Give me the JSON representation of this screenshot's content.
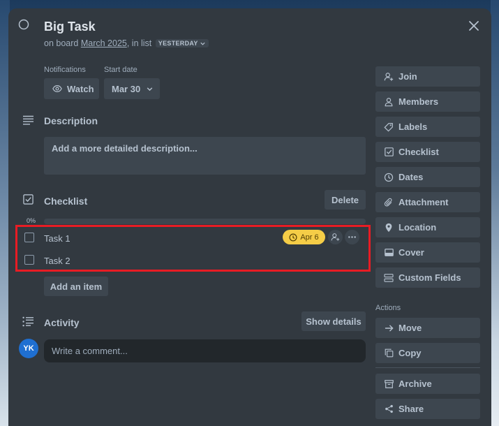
{
  "card": {
    "title": "Big Task",
    "subtitle_prefix": "on board",
    "board_name": "March 2025",
    "subtitle_mid": ", in list",
    "list_name": "YESTERDAY"
  },
  "meta": {
    "notifications_label": "Notifications",
    "watch_label": "Watch",
    "start_date_label": "Start date",
    "start_date_value": "Mar 30"
  },
  "description": {
    "heading": "Description",
    "placeholder": "Add a more detailed description..."
  },
  "checklist": {
    "heading": "Checklist",
    "delete_label": "Delete",
    "progress_text": "0%",
    "progress_value": 0,
    "items": [
      {
        "label": "Task 1",
        "checked": false,
        "due": "Apr 6"
      },
      {
        "label": "Task 2",
        "checked": false
      }
    ],
    "add_item_label": "Add an item"
  },
  "activity": {
    "heading": "Activity",
    "show_details_label": "Show details",
    "avatar_initials": "YK",
    "comment_placeholder": "Write a comment..."
  },
  "sidebar": {
    "items": [
      {
        "label": "Join",
        "icon": "user-add-icon"
      },
      {
        "label": "Members",
        "icon": "user-icon"
      },
      {
        "label": "Labels",
        "icon": "tag-icon"
      },
      {
        "label": "Checklist",
        "icon": "checkbox-icon"
      },
      {
        "label": "Dates",
        "icon": "clock-icon"
      },
      {
        "label": "Attachment",
        "icon": "paperclip-icon"
      },
      {
        "label": "Location",
        "icon": "location-pin-icon"
      },
      {
        "label": "Cover",
        "icon": "cover-icon"
      },
      {
        "label": "Custom Fields",
        "icon": "custom-fields-icon"
      }
    ],
    "actions_label": "Actions",
    "actions": [
      {
        "label": "Move",
        "icon": "arrow-right-icon"
      },
      {
        "label": "Copy",
        "icon": "copy-icon"
      },
      {
        "label": "Archive",
        "icon": "archive-icon"
      },
      {
        "label": "Share",
        "icon": "share-icon"
      }
    ]
  },
  "colors": {
    "modal_bg": "#323940",
    "button_bg": "#3d464f",
    "text": "#b6c2cf",
    "due_badge": "#f5cd47",
    "highlight": "#e81c24",
    "avatar": "#1f6fd1"
  }
}
